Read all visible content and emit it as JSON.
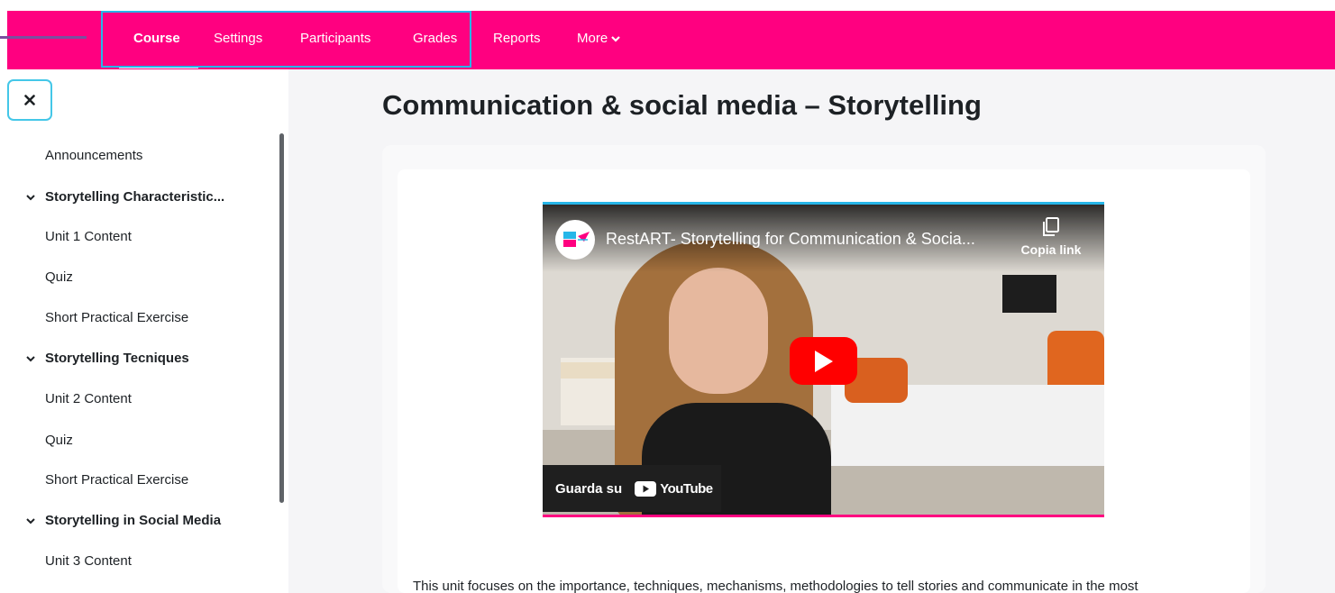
{
  "colors": {
    "navbar": "#ff0080",
    "highlight": "#26b6e8",
    "pointer_line": "#7b4f9e",
    "play_button": "#ff0000"
  },
  "nav": {
    "items": [
      {
        "label": "Course",
        "active": true
      },
      {
        "label": "Settings"
      },
      {
        "label": "Participants"
      },
      {
        "label": "Grades"
      },
      {
        "label": "Reports"
      },
      {
        "label": "More"
      }
    ]
  },
  "drawer": {
    "items": [
      {
        "label": "Announcements",
        "type": "link"
      },
      {
        "label": "Storytelling Characteristic...",
        "type": "section",
        "icon": "chevron-down-icon"
      },
      {
        "label": "Unit 1 Content",
        "type": "link"
      },
      {
        "label": "Quiz",
        "type": "link"
      },
      {
        "label": "Short Practical Exercise",
        "type": "link"
      },
      {
        "label": "Storytelling Tecniques",
        "type": "section",
        "icon": "chevron-down-icon"
      },
      {
        "label": "Unit 2 Content",
        "type": "link"
      },
      {
        "label": "Quiz",
        "type": "link"
      },
      {
        "label": "Short Practical Exercise",
        "type": "link"
      },
      {
        "label": "Storytelling in Social Media",
        "type": "section",
        "icon": "chevron-down-icon"
      },
      {
        "label": "Unit 3 Content",
        "type": "link"
      }
    ]
  },
  "main": {
    "title": "Communication & social media – Storytelling",
    "video": {
      "channel_logo_text": "Rest ART",
      "title": "RestART- Storytelling for Communication & Socia...",
      "copy_label": "Copia link",
      "watch_label": "Guarda su",
      "platform": "YouTube"
    },
    "description": "This unit focuses on the importance, techniques, mechanisms, methodologies to tell stories and communicate in the most"
  }
}
